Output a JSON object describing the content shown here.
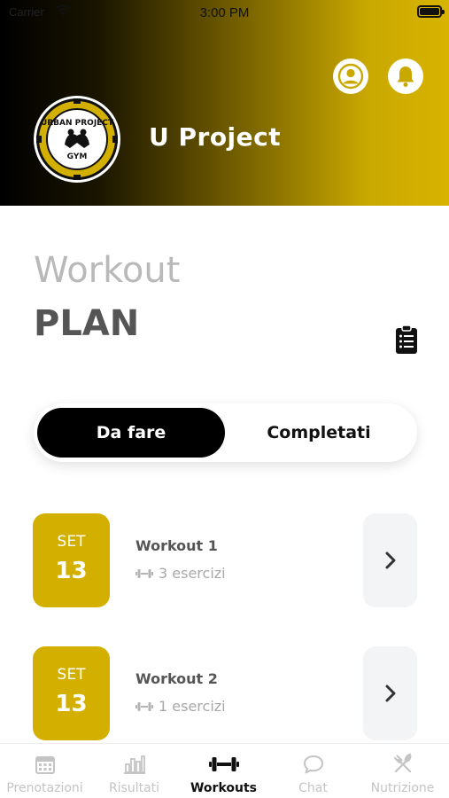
{
  "status_bar": {
    "carrier": "Carrier",
    "time": "3:00 PM"
  },
  "header": {
    "title": "U Project",
    "logo_top": "URBAN PROJECT",
    "logo_bottom": "GYM"
  },
  "page": {
    "title_light": "Workout",
    "title_bold": "PLAN"
  },
  "segment": {
    "active_label": "Da fare",
    "inactive_label": "Completati"
  },
  "workouts": [
    {
      "month": "SET",
      "day": "13",
      "name": "Workout 1",
      "subtitle": "3 esercizi"
    },
    {
      "month": "SET",
      "day": "13",
      "name": "Workout 2",
      "subtitle": "1 esercizi"
    }
  ],
  "tabs": [
    {
      "label": "Prenotazioni",
      "icon": "calendar-icon",
      "active": false
    },
    {
      "label": "Risultati",
      "icon": "bar-chart-icon",
      "active": false
    },
    {
      "label": "Workouts",
      "icon": "dumbbell-icon",
      "active": true
    },
    {
      "label": "Chat",
      "icon": "chat-icon",
      "active": false
    },
    {
      "label": "Nutrizione",
      "icon": "utensils-icon",
      "active": false
    }
  ],
  "colors": {
    "accent": "#D3B000",
    "header_start": "#000000",
    "header_end": "#D8B400"
  }
}
